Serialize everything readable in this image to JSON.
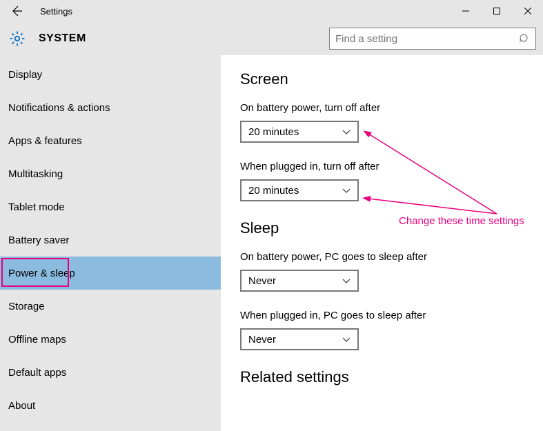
{
  "window": {
    "title": "Settings"
  },
  "header": {
    "title": "SYSTEM"
  },
  "search": {
    "placeholder": "Find a setting"
  },
  "sidebar": {
    "items": [
      {
        "label": "Display"
      },
      {
        "label": "Notifications & actions"
      },
      {
        "label": "Apps & features"
      },
      {
        "label": "Multitasking"
      },
      {
        "label": "Tablet mode"
      },
      {
        "label": "Battery saver"
      },
      {
        "label": "Power & sleep"
      },
      {
        "label": "Storage"
      },
      {
        "label": "Offline maps"
      },
      {
        "label": "Default apps"
      },
      {
        "label": "About"
      }
    ]
  },
  "content": {
    "screen": {
      "heading": "Screen",
      "battery_label": "On battery power, turn off after",
      "battery_value": "20 minutes",
      "plugged_label": "When plugged in, turn off after",
      "plugged_value": "20 minutes"
    },
    "sleep": {
      "heading": "Sleep",
      "battery_label": "On battery power, PC goes to sleep after",
      "battery_value": "Never",
      "plugged_label": "When plugged in, PC goes to sleep after",
      "plugged_value": "Never"
    },
    "related": {
      "heading": "Related settings"
    }
  },
  "annotation": {
    "text": "Change these time settings"
  }
}
